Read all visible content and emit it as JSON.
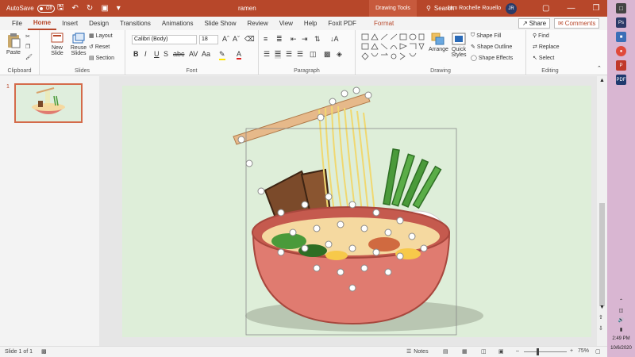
{
  "titlebar": {
    "autosave_label": "AutoSave",
    "autosave_state": "Off",
    "doc_title": "ramen",
    "context_tab": "Drawing Tools",
    "search_label": "Search",
    "user_name": "Jam Rochelle Rouello",
    "user_initials": "JR"
  },
  "tabs": [
    "File",
    "Home",
    "Insert",
    "Design",
    "Transitions",
    "Animations",
    "Slide Show",
    "Review",
    "View",
    "Help",
    "Foxit PDF"
  ],
  "format_tab": "Format",
  "share_label": "Share",
  "comments_label": "Comments",
  "ribbon": {
    "clipboard": {
      "label": "Clipboard",
      "paste": "Paste"
    },
    "slides": {
      "label": "Slides",
      "new_slide": "New Slide",
      "reuse_slides": "Reuse Slides",
      "layout": "Layout",
      "reset": "Reset",
      "section": "Section"
    },
    "font": {
      "label": "Font",
      "font_name": "Calibri (Body)",
      "font_size": "18"
    },
    "paragraph": {
      "label": "Paragraph"
    },
    "drawing": {
      "label": "Drawing",
      "arrange": "Arrange",
      "quick_styles": "Quick Styles",
      "shape_fill": "Shape Fill",
      "shape_outline": "Shape Outline",
      "shape_effects": "Shape Effects"
    },
    "editing": {
      "label": "Editing",
      "find": "Find",
      "replace": "Replace",
      "select": "Select"
    }
  },
  "thumbs": {
    "slide_number": "1"
  },
  "statusbar": {
    "slide_info": "Slide 1 of 1",
    "notes": "Notes",
    "zoom": "75%"
  },
  "taskbar": {
    "time": "2:49 PM",
    "date": "10/6/2020"
  },
  "colors": {
    "accent": "#b7472a",
    "slide_bg": "#deeed9",
    "bowl": "#e07b70",
    "noodle": "#f5e89a",
    "scallion": "#4a9a3a"
  }
}
